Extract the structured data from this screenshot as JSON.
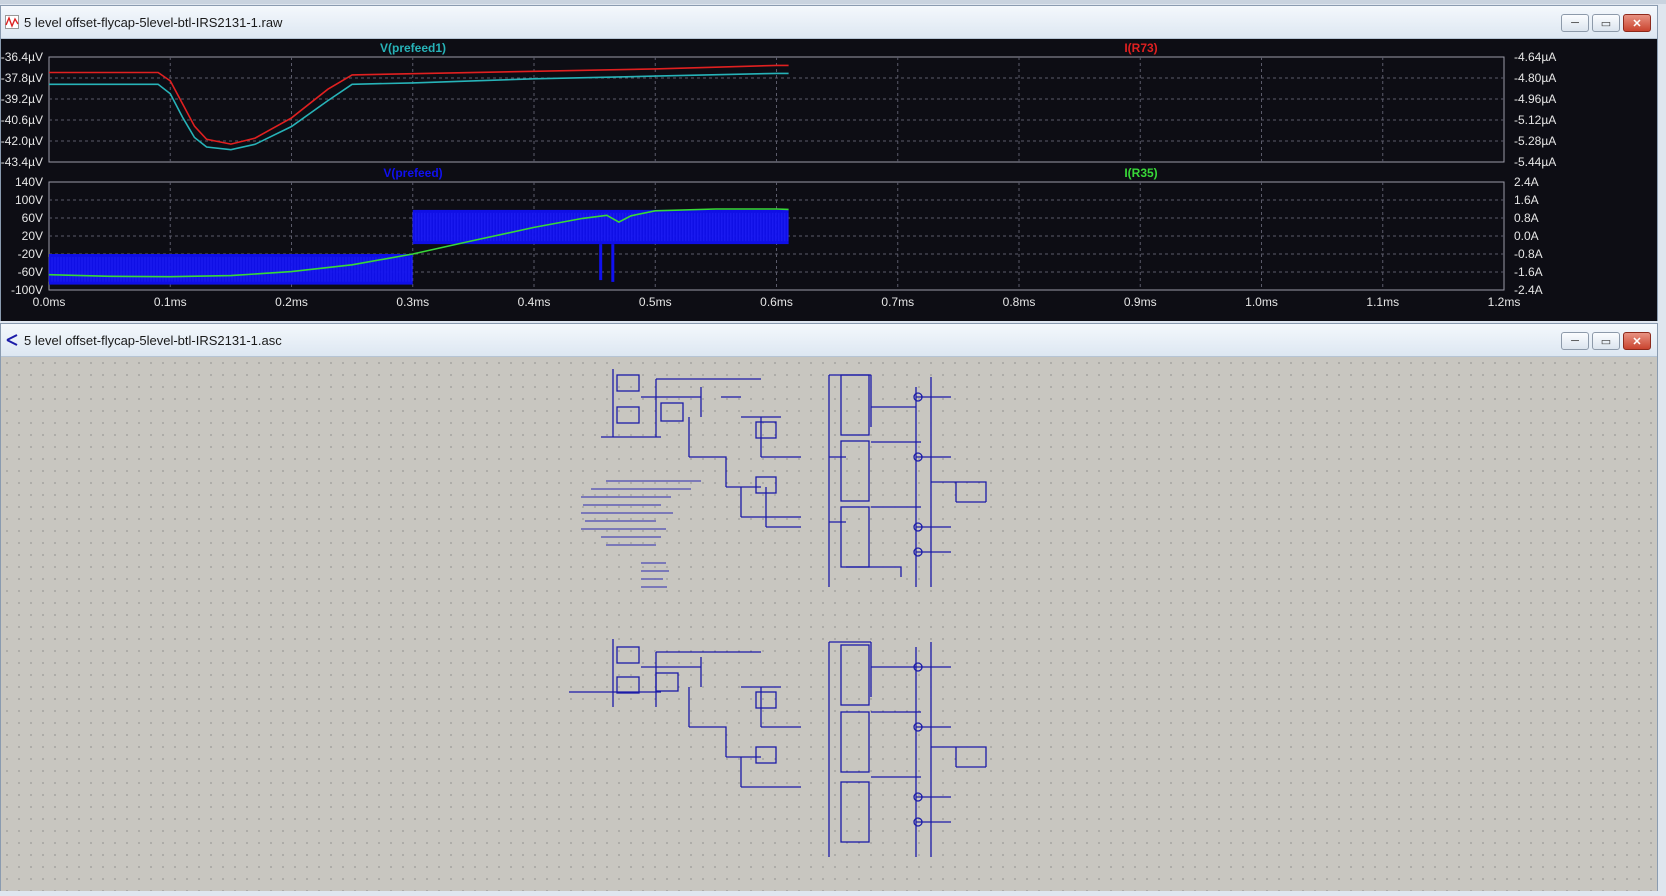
{
  "waveform_window": {
    "title": "5 level offset-flycap-5level-btl-IRS2131-1.raw",
    "icon": "waveform-icon"
  },
  "schematic_window": {
    "title": "5 level offset-flycap-5level-btl-IRS2131-1.asc",
    "icon": "schematic-icon"
  },
  "window_buttons": {
    "minimize": "─",
    "maximize": "▭",
    "close": "✕"
  },
  "colors": {
    "plot_bg": "#0d0d14",
    "grid": "#5b5b6a",
    "trace_cyan": "#27b3b8",
    "trace_red": "#e02020",
    "trace_blue": "#1010f0",
    "trace_green": "#38d838",
    "schematic_bg": "#c8c6c0",
    "wire": "#1b1ba8"
  },
  "chart_data": [
    {
      "type": "line",
      "xlim": [
        0,
        1.2
      ],
      "x_unit": "ms",
      "left_axis": {
        "ticks": [
          "-36.4µV",
          "-37.8µV",
          "-39.2µV",
          "-40.6µV",
          "-42.0µV",
          "-43.4µV"
        ],
        "ylim": [
          -43.4,
          -35.7
        ]
      },
      "right_axis": {
        "ticks": [
          "-4.64µA",
          "-4.80µA",
          "-4.96µA",
          "-5.12µA",
          "-5.28µA",
          "-5.44µA"
        ],
        "ylim": [
          -5.44,
          -4.56
        ]
      },
      "series": [
        {
          "name": "V(prefeed1)",
          "color": "#27b3b8",
          "axis": "left",
          "points": [
            [
              0,
              -37.7
            ],
            [
              0.09,
              -37.7
            ],
            [
              0.1,
              -38.4
            ],
            [
              0.11,
              -40.1
            ],
            [
              0.12,
              -41.6
            ],
            [
              0.13,
              -42.3
            ],
            [
              0.15,
              -42.5
            ],
            [
              0.17,
              -42.1
            ],
            [
              0.2,
              -40.8
            ],
            [
              0.23,
              -38.9
            ],
            [
              0.25,
              -37.7
            ],
            [
              0.3,
              -37.6
            ],
            [
              0.4,
              -37.3
            ],
            [
              0.5,
              -37.1
            ],
            [
              0.6,
              -36.9
            ],
            [
              0.61,
              -36.9
            ]
          ]
        },
        {
          "name": "I(R73)",
          "color": "#e02020",
          "axis": "right",
          "points": [
            [
              0,
              -4.69
            ],
            [
              0.09,
              -4.69
            ],
            [
              0.1,
              -4.76
            ],
            [
              0.11,
              -4.95
            ],
            [
              0.12,
              -5.14
            ],
            [
              0.13,
              -5.25
            ],
            [
              0.15,
              -5.29
            ],
            [
              0.17,
              -5.24
            ],
            [
              0.2,
              -5.07
            ],
            [
              0.23,
              -4.83
            ],
            [
              0.25,
              -4.71
            ],
            [
              0.3,
              -4.7
            ],
            [
              0.4,
              -4.68
            ],
            [
              0.5,
              -4.66
            ],
            [
              0.6,
              -4.63
            ],
            [
              0.61,
              -4.63
            ]
          ]
        }
      ]
    },
    {
      "type": "line",
      "xlim": [
        0,
        1.2
      ],
      "x_unit": "ms",
      "x_ticks": [
        "0.0ms",
        "0.1ms",
        "0.2ms",
        "0.3ms",
        "0.4ms",
        "0.5ms",
        "0.6ms",
        "0.7ms",
        "0.8ms",
        "0.9ms",
        "1.0ms",
        "1.1ms",
        "1.2ms"
      ],
      "left_axis": {
        "ticks": [
          "140V",
          "100V",
          "60V",
          "20V",
          "-20V",
          "-60V",
          "-100V"
        ],
        "ylim": [
          -100,
          140
        ]
      },
      "right_axis": {
        "ticks": [
          "2.4A",
          "1.6A",
          "0.8A",
          "0.0A",
          "-0.8A",
          "-1.6A",
          "-2.4A"
        ],
        "ylim": [
          -2.4,
          2.4
        ]
      },
      "series": [
        {
          "name": "V(prefeed)",
          "color": "#1010f0",
          "axis": "left",
          "style": "switching",
          "segments": [
            {
              "x": [
                0,
                0.3
              ],
              "low": -88,
              "high": -20
            },
            {
              "x": [
                0.3,
                0.61
              ],
              "low": 2,
              "high": 78
            }
          ],
          "spikes": [
            [
              0.455,
              -78
            ],
            [
              0.465,
              -82
            ]
          ]
        },
        {
          "name": "I(R35)",
          "color": "#38d838",
          "axis": "right",
          "points": [
            [
              0,
              -1.72
            ],
            [
              0.05,
              -1.79
            ],
            [
              0.1,
              -1.81
            ],
            [
              0.15,
              -1.76
            ],
            [
              0.2,
              -1.58
            ],
            [
              0.25,
              -1.28
            ],
            [
              0.3,
              -0.8
            ],
            [
              0.35,
              -0.2
            ],
            [
              0.4,
              0.38
            ],
            [
              0.44,
              0.78
            ],
            [
              0.46,
              0.92
            ],
            [
              0.47,
              0.62
            ],
            [
              0.48,
              0.9
            ],
            [
              0.5,
              1.12
            ],
            [
              0.55,
              1.2
            ],
            [
              0.6,
              1.2
            ],
            [
              0.61,
              1.18
            ]
          ]
        }
      ]
    }
  ]
}
